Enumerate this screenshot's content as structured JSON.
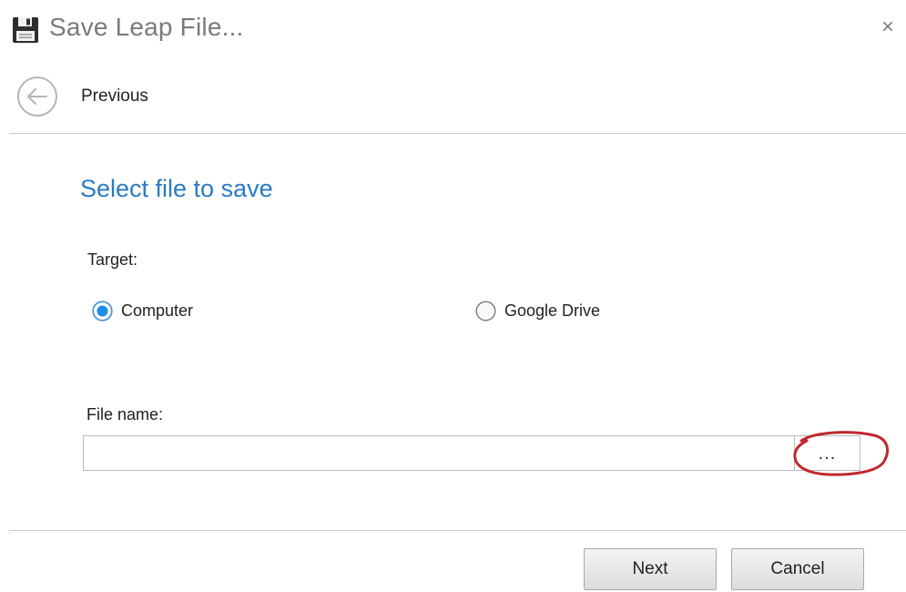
{
  "window": {
    "title": "Save Leap File...",
    "title_icon": "floppy-disk-icon",
    "close_glyph": "×"
  },
  "navigation": {
    "previous_label": "Previous",
    "previous_icon": "back-arrow-circle-icon"
  },
  "main": {
    "section_title": "Select file to save",
    "target_label": "Target:",
    "target_options": [
      {
        "label": "Computer",
        "selected": true
      },
      {
        "label": "Google Drive",
        "selected": false
      }
    ],
    "file_name_label": "File name:",
    "file_name_value": "",
    "file_name_placeholder": "",
    "browse_label": "..."
  },
  "footer": {
    "next_label": "Next",
    "cancel_label": "Cancel"
  },
  "colors": {
    "accent": "#2b7ac1",
    "radio_selected": "#1e8fe6",
    "annotation": "#c0282e"
  }
}
